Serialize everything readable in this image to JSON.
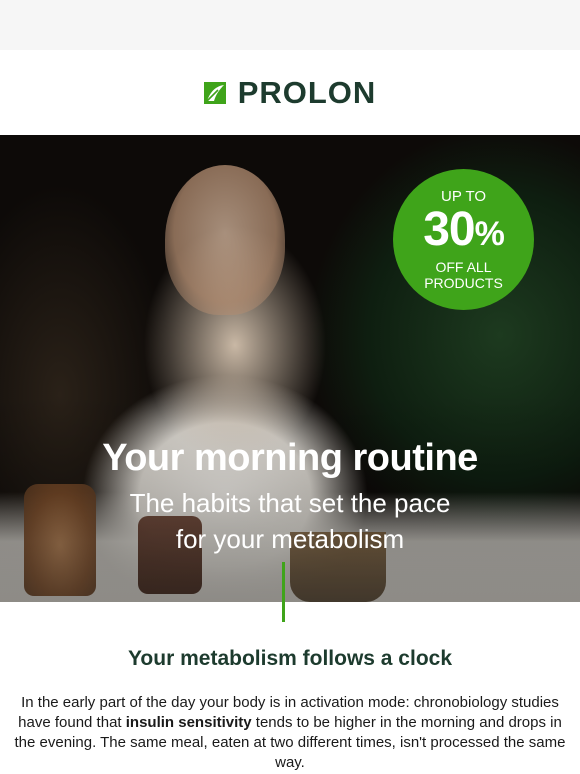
{
  "brand": {
    "name": "PROLON",
    "color": "#1d3b2e",
    "accent": "#3fa41a"
  },
  "badge": {
    "line1": "UP TO",
    "number": "30",
    "percent": "%",
    "line3a": "OFF ALL",
    "line3b": "PRODUCTS"
  },
  "hero": {
    "title": "Your morning routine",
    "subtitle_line1": "The habits that set the pace",
    "subtitle_line2": "for your metabolism"
  },
  "section": {
    "title": "Your metabolism follows a clock",
    "body_before": "In the early part of the day your body is in activation mode: chronobiology studies have found that ",
    "body_bold": "insulin sensitivity",
    "body_after": " tends to be higher in the morning and drops in the evening. The same meal, eaten at two different times, isn't processed the same way."
  },
  "icons": {
    "logo": "prolon-leaf-icon"
  }
}
